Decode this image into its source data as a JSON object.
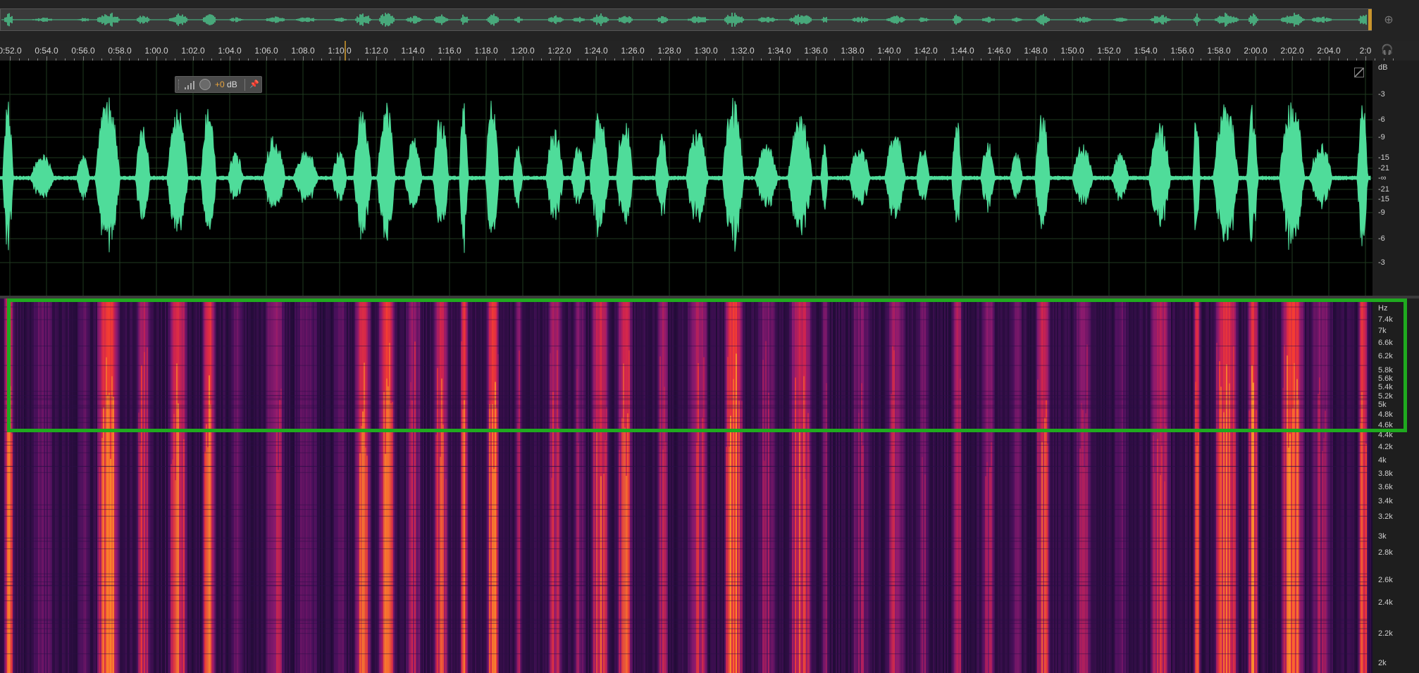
{
  "overview": {
    "zoom_icon": "zoom-navigator-icon"
  },
  "timeline": {
    "tick_labels": [
      "0:52.0",
      "0:54.0",
      "0:56.0",
      "0:58.0",
      "1:00.0",
      "1:02.0",
      "1:04.0",
      "1:06.0",
      "1:08.0",
      "1:10.0",
      "1:12.0",
      "1:14.0",
      "1:16.0",
      "1:18.0",
      "1:20.0",
      "1:22.0",
      "1:24.0",
      "1:26.0",
      "1:28.0",
      "1:30.0",
      "1:32.0",
      "1:34.0",
      "1:36.0",
      "1:38.0",
      "1:40.0",
      "1:42.0",
      "1:44.0",
      "1:46.0",
      "1:48.0",
      "1:50.0",
      "1:52.0",
      "1:54.0",
      "1:56.0",
      "1:58.0",
      "2:00.0",
      "2:02.0",
      "2:04.0",
      "2:0"
    ],
    "headphones_icon": "headphones-icon"
  },
  "hud": {
    "value_sign": "+0",
    "value_unit": " dB",
    "pin_icon": "pin-icon"
  },
  "waveform": {
    "color": "#4fdc9a",
    "db_labels": [
      "dB",
      "-3",
      "-6",
      "-9",
      "-15",
      "-21",
      "-∞",
      "-21",
      "-15",
      "-9",
      "-6",
      "-3"
    ]
  },
  "spectrogram": {
    "hz_labels": [
      "Hz",
      "7.4k",
      "7k",
      "6.6k",
      "6.2k",
      "5.8k",
      "5.6k",
      "5.4k",
      "5.2k",
      "5k",
      "4.8k",
      "4.6k",
      "4.4k",
      "4.2k",
      "4k",
      "3.8k",
      "3.6k",
      "3.4k",
      "3.2k",
      "3k",
      "2.8k",
      "2.6k",
      "2.4k",
      "2.2k",
      "2k"
    ]
  },
  "colors": {
    "accent": "#c9952d",
    "highlight": "#1faa1f",
    "spectrogram_bg": "#1d0b33",
    "spectrogram_hot": "#ff3d2e"
  }
}
